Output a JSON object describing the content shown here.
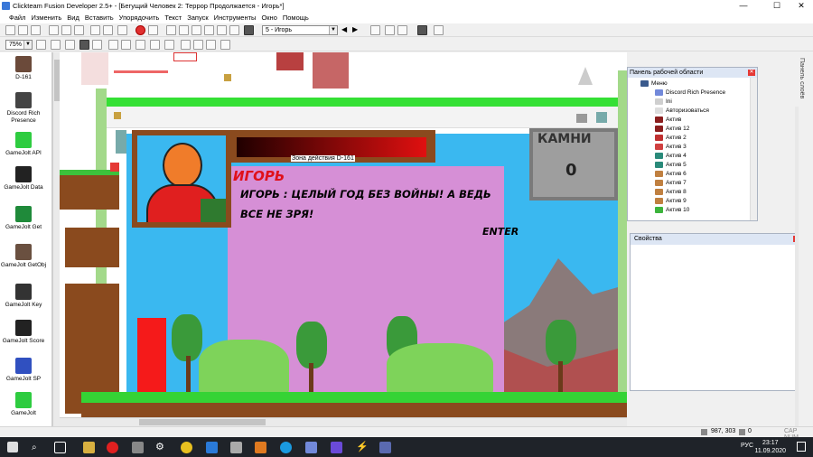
{
  "window": {
    "title": "Clickteam Fusion Developer 2.5+ - [Бегущий Человек 2: Террор Продолжается - Игорь*]",
    "controls": [
      "—",
      "☐",
      "✕"
    ]
  },
  "menu": {
    "items": [
      "Файл",
      "Изменить",
      "Вид",
      "Вставить",
      "Упорядочить",
      "Текст",
      "Запуск",
      "Инструменты",
      "Окно",
      "Помощь"
    ]
  },
  "toolbar2": {
    "frame_select": "5 - Игорь",
    "zoom": "75%"
  },
  "objects": [
    {
      "label": "D-161",
      "icon": "object-d161-icon"
    },
    {
      "label": "Discord Rich Presence",
      "icon": "discord-icon"
    },
    {
      "label": "GameJolt API",
      "icon": "gamejolt-api-icon"
    },
    {
      "label": "GameJolt Data",
      "icon": "gamejolt-data-icon"
    },
    {
      "label": "GameJolt Get",
      "icon": "gamejolt-get-icon"
    },
    {
      "label": "GameJolt GetObj",
      "icon": "gamejolt-getobj-icon"
    },
    {
      "label": "GameJolt Key",
      "icon": "gamejolt-key-icon"
    },
    {
      "label": "GameJolt Score",
      "icon": "gamejolt-score-icon"
    },
    {
      "label": "GameJolt SP",
      "icon": "gamejolt-sp-icon"
    },
    {
      "label": "GameJolt",
      "icon": "gamejolt-icon"
    }
  ],
  "scene": {
    "enter_top": "ENTER",
    "enter_mid": "ENTER",
    "zone_label": "Зона действия D-161",
    "speaker_name": "ИГОРЬ",
    "dialog_text": "ИГОРЬ :  ЦЕЛЫЙ ГОД БЕЗ ВОЙНЫ! А ВЕДЬ ВСЕ НЕ ЗРЯ!",
    "stones_label": "КАМНИ",
    "stones_count": "0"
  },
  "workspace": {
    "title": "Панель рабочей области",
    "items": [
      {
        "label": "Меню",
        "color": "#3a5a8c"
      },
      {
        "label": "Discord Rich Presence",
        "color": "#7289da"
      },
      {
        "label": "Ini",
        "color": "#cfcfcf"
      },
      {
        "label": "Авторизоваться",
        "color": "#dddddd"
      },
      {
        "label": "Актив",
        "color": "#8b1e1e"
      },
      {
        "label": "Актив 12",
        "color": "#8b1e1e"
      },
      {
        "label": "Актив 2",
        "color": "#c03030"
      },
      {
        "label": "Актив 3",
        "color": "#d04040"
      },
      {
        "label": "Актив 4",
        "color": "#2a8a7a"
      },
      {
        "label": "Актив 5",
        "color": "#2a8a7a"
      },
      {
        "label": "Актив 6",
        "color": "#c08040"
      },
      {
        "label": "Актив 7",
        "color": "#c08040"
      },
      {
        "label": "Актив 8",
        "color": "#c08040"
      },
      {
        "label": "Актив 9",
        "color": "#c08040"
      },
      {
        "label": "Актив 10",
        "color": "#3cb43c"
      }
    ]
  },
  "properties": {
    "title": "Свойства"
  },
  "side_tab": "Панель слоёв",
  "status": {
    "coords": "987, 303",
    "layer": "0",
    "keys": "CAP NUM"
  },
  "taskbar": {
    "lang": "РУС",
    "time": "23:17",
    "date": "11.09.2020"
  }
}
